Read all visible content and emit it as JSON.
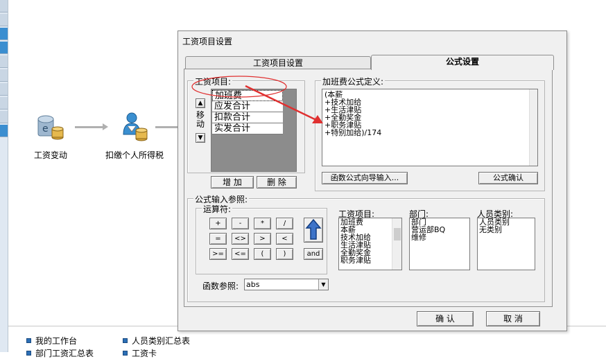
{
  "flow": {
    "items": [
      {
        "label": "工资变动"
      },
      {
        "label": "扣缴个人所得税"
      }
    ]
  },
  "bottom": {
    "links": [
      {
        "label": "我的工作台"
      },
      {
        "label": "人员类别汇总表"
      },
      {
        "label": "部门工资汇总表"
      },
      {
        "label": "工资卡"
      }
    ]
  },
  "dialog": {
    "title": "工资项目设置",
    "tabs": [
      {
        "label": "工资项目设置"
      },
      {
        "label": "公式设置"
      }
    ],
    "salary_items_group": "工资项目:",
    "salary_items": [
      "加班费",
      "应发合计",
      "扣款合计",
      "实发合计"
    ],
    "move_label": "移动",
    "up_glyph": "▲",
    "down_glyph": "▼",
    "add_label": "增 加",
    "delete_label": "删 除",
    "formula_group": "加班费公式定义:",
    "formula_lines": [
      "(本薪",
      "+技术加给",
      "+生活津贴",
      "+全勤奖金",
      "+职务津贴",
      "+特别加给)/174"
    ],
    "wizard_button": "函数公式向导输入...",
    "confirm_formula": "公式确认",
    "ref_group": "公式输入参照:",
    "operators_group": "运算符:",
    "operators": [
      "+",
      "-",
      "*",
      "/",
      "=",
      "<>",
      ">",
      "<",
      ">=",
      "<=",
      "(",
      ")"
    ],
    "and_label": "and",
    "items_header": "工资项目:",
    "items_list": [
      "加班费",
      "本薪",
      "技术加给",
      "生活津贴",
      "全勤奖金",
      "职务津贴"
    ],
    "dept_header": "部门:",
    "dept_list": [
      "部门",
      "营运部BQ",
      "维修"
    ],
    "category_header": "人员类别:",
    "category_list": [
      "人员类别",
      "无类别"
    ],
    "func_label": "函数参照:",
    "func_value": "abs",
    "ok_label": "确 认",
    "cancel_label": "取 消"
  },
  "colors": {
    "annotation": "#e03030",
    "accent": "#2c6fb6"
  }
}
